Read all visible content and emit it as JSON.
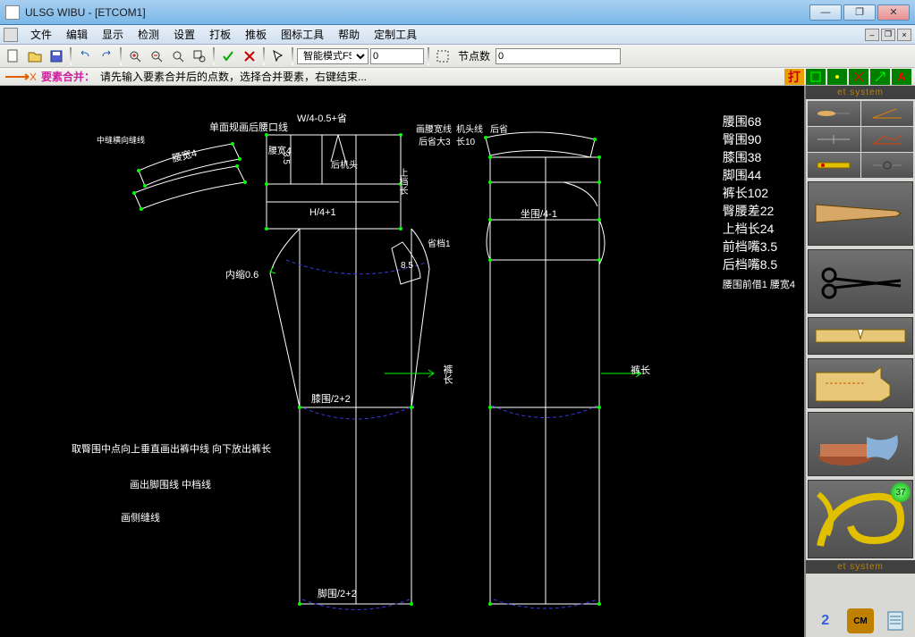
{
  "title": "ULSG WIBU - [ETCOM1]",
  "menu": {
    "items": [
      "文件",
      "编辑",
      "显示",
      "检测",
      "设置",
      "打板",
      "推板",
      "图标工具",
      "帮助",
      "定制工具"
    ]
  },
  "toolbar": {
    "mode_label": "智能模式F5",
    "mode_value": "0",
    "nodes_label": "节点数",
    "nodes_value": "0"
  },
  "hint": {
    "tool_name": "要素合并：",
    "message": "请先输入要素合并后的点数，选择合并要素，右键结束..."
  },
  "measurements": [
    "腰围68",
    "臀围90",
    "膝围38",
    "脚围44",
    "裤长102",
    "臀腰差22",
    "上档长24",
    "前档嘴3.5",
    "后档嘴8.5"
  ],
  "meas_sub": "腰围前借1 腰宽4",
  "labels": {
    "title_top": "W/4-0.5+省",
    "title_sub": "单面规画后腰口线",
    "waist_w": "腰宽4",
    "waist_w2": "腰宽4",
    "side_note": "中缝横向缝线",
    "h4": "H/4+1",
    "inner_shrink": "内缩0.6",
    "knee": "膝围/2+2",
    "foot": "脚围/2+2",
    "instruction1": "取臀围中点向上垂直画出裤中线  向下放出裤长",
    "instruction2": "画出脚围线  中档线",
    "instruction3": "画侧缝线",
    "seat": "坐围/4-1",
    "pants_len": "裤长",
    "back_top1": "画腰宽线",
    "back_top2": "机头线",
    "back_top3": "后省",
    "back_top4": "后省大3",
    "back_top5": "长10",
    "num35": "3.5",
    "jk_head": "后机头",
    "dart1": "省档1",
    "num85": "8.5",
    "vertical_label": "上档长",
    "arrow_label": "裤长"
  },
  "side": {
    "system": "et system",
    "bottom_num": "2",
    "bottom_cm": "CM",
    "wheel": "37"
  }
}
